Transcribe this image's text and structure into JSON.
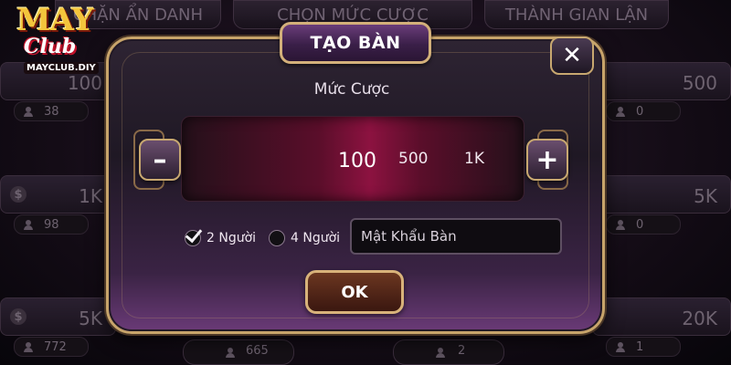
{
  "background": {
    "headers": [
      "CHẶN ẨN DANH",
      "CHỌN MỨC CƯỢC",
      "THÀNH GIAN LẬN"
    ],
    "left_cards": [
      {
        "amount": "100",
        "players": "38"
      },
      {
        "amount": "1K",
        "players": "98"
      },
      {
        "amount": "5K",
        "players": "772"
      }
    ],
    "right_cards": [
      {
        "amount": "500",
        "players": "0"
      },
      {
        "amount": "5K",
        "players": "0"
      },
      {
        "amount": "20K",
        "players": "1"
      }
    ],
    "bottom_counts": [
      "665",
      "2"
    ]
  },
  "logo": {
    "line1": "MAY",
    "line2": "Club",
    "site": "MAYCLUB.DIY"
  },
  "modal": {
    "title": "TẠO BÀN",
    "close_symbol": "✕",
    "bet_label": "Mức Cược",
    "bet_options": [
      "100",
      "500",
      "1K"
    ],
    "selected_bet": "100",
    "minus_symbol": "–",
    "plus_symbol": "+",
    "player_options": [
      {
        "label": "2 Người",
        "checked": true
      },
      {
        "label": "4 Người",
        "checked": false
      }
    ],
    "password_placeholder": "Mật Khẩu Bàn",
    "ok_label": "OK"
  }
}
